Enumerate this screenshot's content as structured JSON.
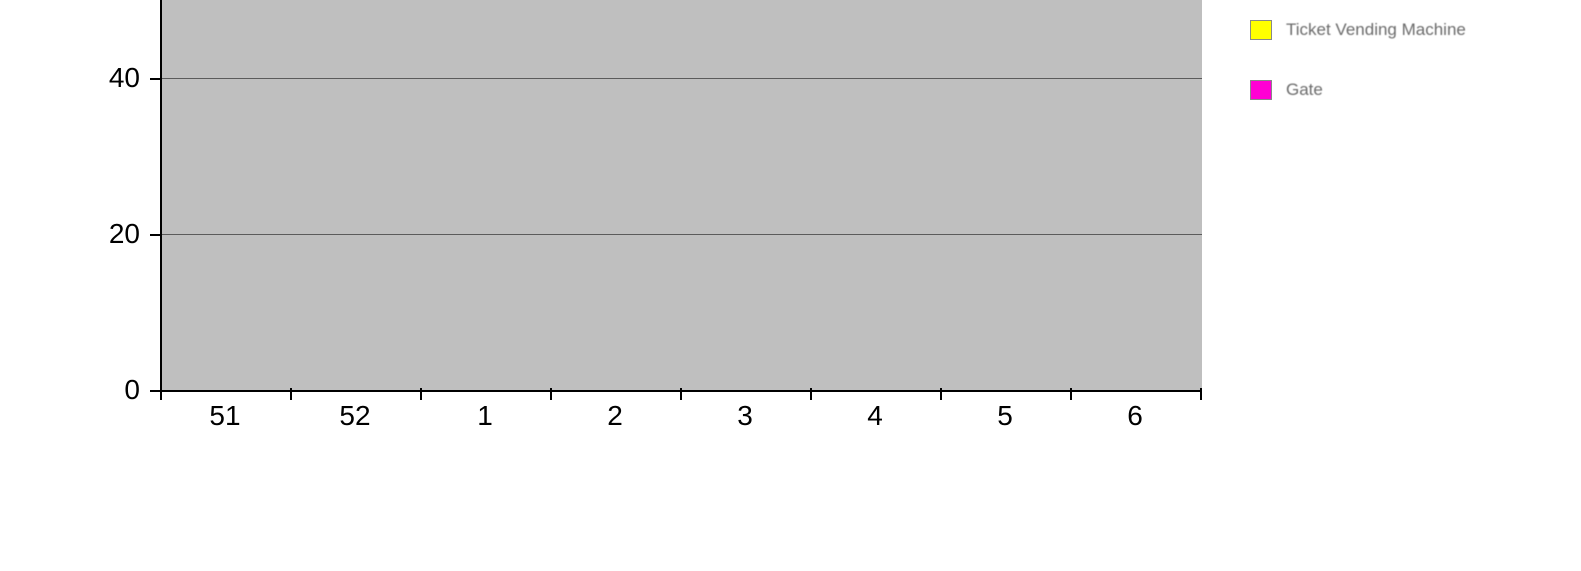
{
  "chart_data": {
    "type": "line",
    "categories": [
      "51",
      "52",
      "1",
      "2",
      "3",
      "4",
      "5",
      "6"
    ],
    "series": [
      {
        "name": "Ticket Vending Machine",
        "color": "#ffff00",
        "values": [
          null,
          null,
          null,
          null,
          null,
          null,
          null,
          null
        ]
      },
      {
        "name": "Gate",
        "color": "#ff00d4",
        "values": [
          null,
          null,
          null,
          null,
          null,
          null,
          null,
          null
        ]
      }
    ],
    "y_ticks": [
      0,
      20,
      40
    ],
    "ylim": [
      0,
      50
    ],
    "grid": true,
    "legend_position": "right",
    "xlabel": "",
    "ylabel": "",
    "title": ""
  },
  "y": {
    "t0": "0",
    "t1": "20",
    "t2": "40"
  },
  "x": {
    "c0": "51",
    "c1": "52",
    "c2": "1",
    "c3": "2",
    "c4": "3",
    "c5": "4",
    "c6": "5",
    "c7": "6"
  },
  "legend": {
    "a": "Ticket Vending Machine",
    "b": "Gate"
  }
}
